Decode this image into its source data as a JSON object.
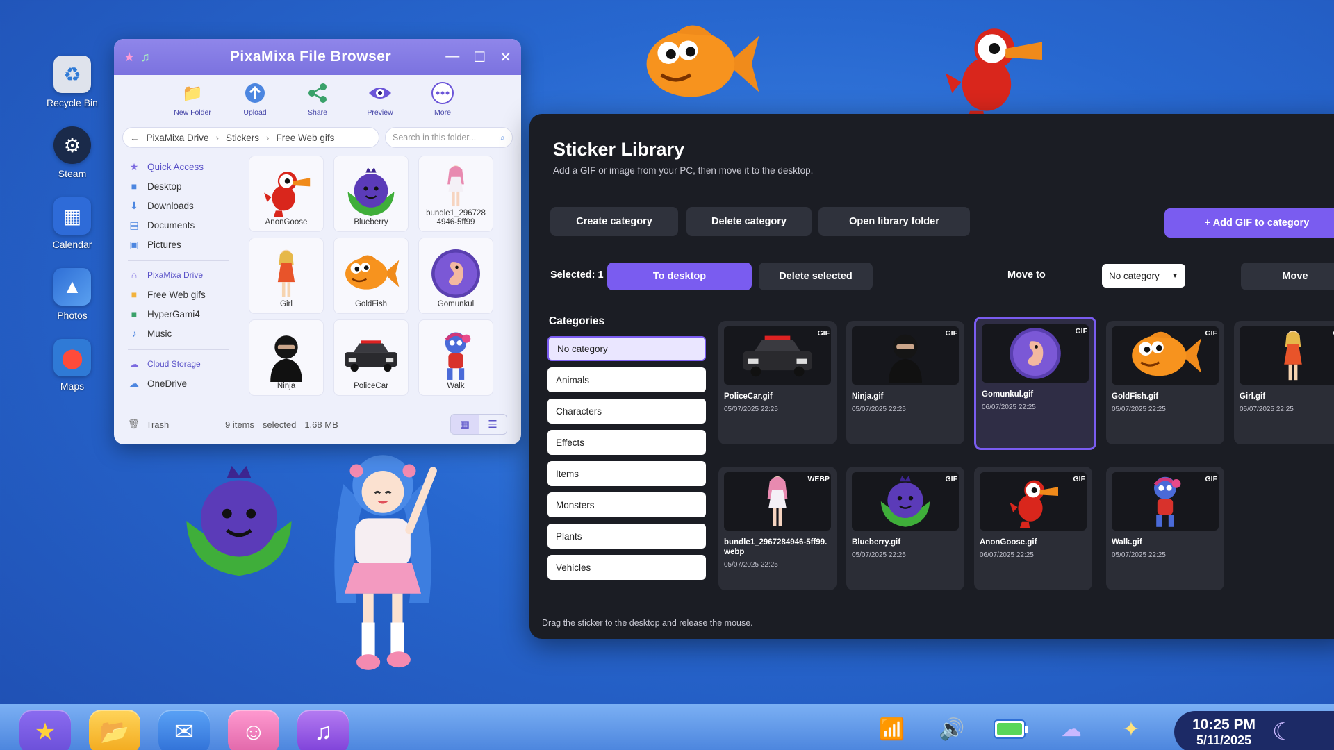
{
  "desktop": {
    "icons": [
      {
        "label": "Recycle Bin",
        "icon": "recycle-bin-icon",
        "color": "#d9dde6"
      },
      {
        "label": "Steam",
        "icon": "steam-icon",
        "color": "#1a2a4a"
      },
      {
        "label": "Calendar",
        "icon": "calendar-icon",
        "color": "#2e6bd8"
      },
      {
        "label": "Photos",
        "icon": "photos-icon",
        "color": "#3b78d9"
      },
      {
        "label": "Maps",
        "icon": "maps-icon",
        "color": "#2f7ad6"
      }
    ]
  },
  "file_browser": {
    "title": "PixaMixa File Browser",
    "toolbar": {
      "new_folder": "New Folder",
      "upload": "Upload",
      "share": "Share",
      "preview": "Preview",
      "more": "More"
    },
    "breadcrumb": [
      "PixaMixa Drive",
      "Stickers",
      "Free Web gifs"
    ],
    "search_placeholder": "Search in this folder...",
    "sidebar": {
      "quick_access": "Quick Access",
      "quick_items": [
        "Desktop",
        "Downloads",
        "Documents",
        "Pictures"
      ],
      "drive_head": "PixaMixa Drive",
      "drive_items": [
        "Free Web gifs",
        "HyperGami4",
        "Music"
      ],
      "cloud_head": "Cloud Storage",
      "cloud_items": [
        "OneDrive"
      ],
      "trash": "Trash"
    },
    "files": [
      "AnonGoose",
      "Blueberry",
      "bundle1_2967284946-5ff99",
      "Girl",
      "GoldFish",
      "Gomunkul",
      "Ninja",
      "PoliceCar",
      "Walk"
    ],
    "status": {
      "items": "9 items",
      "selected": "selected",
      "size": "1.68 MB"
    }
  },
  "sticker_library": {
    "title": "Sticker Library",
    "subtitle": "Add a GIF or image from your PC, then move it to the desktop.",
    "buttons": {
      "create_category": "Create category",
      "delete_category": "Delete category",
      "open_library_folder": "Open library folder",
      "add_gif": "+ Add GIF to category",
      "to_desktop": "To desktop",
      "delete_selected": "Delete selected",
      "move": "Move"
    },
    "selected_label": "Selected: 1",
    "move_to_label": "Move to",
    "move_to_value": "No category",
    "categories_title": "Categories",
    "categories": [
      "No category",
      "Animals",
      "Characters",
      "Effects",
      "Items",
      "Monsters",
      "Plants",
      "Vehicles"
    ],
    "active_category": "No category",
    "cards": [
      {
        "name": "PoliceCar.gif",
        "type": "GIF",
        "date": "05/07/2025 22:25",
        "thumb": "police-car"
      },
      {
        "name": "Ninja.gif",
        "type": "GIF",
        "date": "05/07/2025 22:25",
        "thumb": "ninja"
      },
      {
        "name": "Gomunkul.gif",
        "type": "GIF",
        "date": "06/07/2025 22:25",
        "thumb": "gomunkul",
        "selected": true
      },
      {
        "name": "GoldFish.gif",
        "type": "GIF",
        "date": "05/07/2025 22:25",
        "thumb": "goldfish"
      },
      {
        "name": "Girl.gif",
        "type": "GIF",
        "date": "05/07/2025 22:25",
        "thumb": "girl"
      },
      {
        "name": "bundle1_2967284946-5ff99.webp",
        "type": "WEBP",
        "date": "05/07/2025 22:25",
        "thumb": "bundle"
      },
      {
        "name": "Blueberry.gif",
        "type": "GIF",
        "date": "05/07/2025 22:25",
        "thumb": "blueberry"
      },
      {
        "name": "AnonGoose.gif",
        "type": "GIF",
        "date": "06/07/2025 22:25",
        "thumb": "goose"
      },
      {
        "name": "Walk.gif",
        "type": "GIF",
        "date": "05/07/2025 22:25",
        "thumb": "walk"
      }
    ],
    "hint": "Drag the sticker to the desktop and release the mouse.",
    "accent": "#7a5cf0"
  },
  "taskbar": {
    "apps": [
      "favorites-star-icon",
      "folder-icon",
      "mail-icon",
      "chat-icon",
      "music-icon"
    ],
    "tray": [
      "wifi-icon",
      "volume-icon",
      "battery-icon",
      "weather-cloud-icon",
      "sparkle-icon"
    ],
    "time": "10:25 PM",
    "date": "5/11/2025"
  }
}
